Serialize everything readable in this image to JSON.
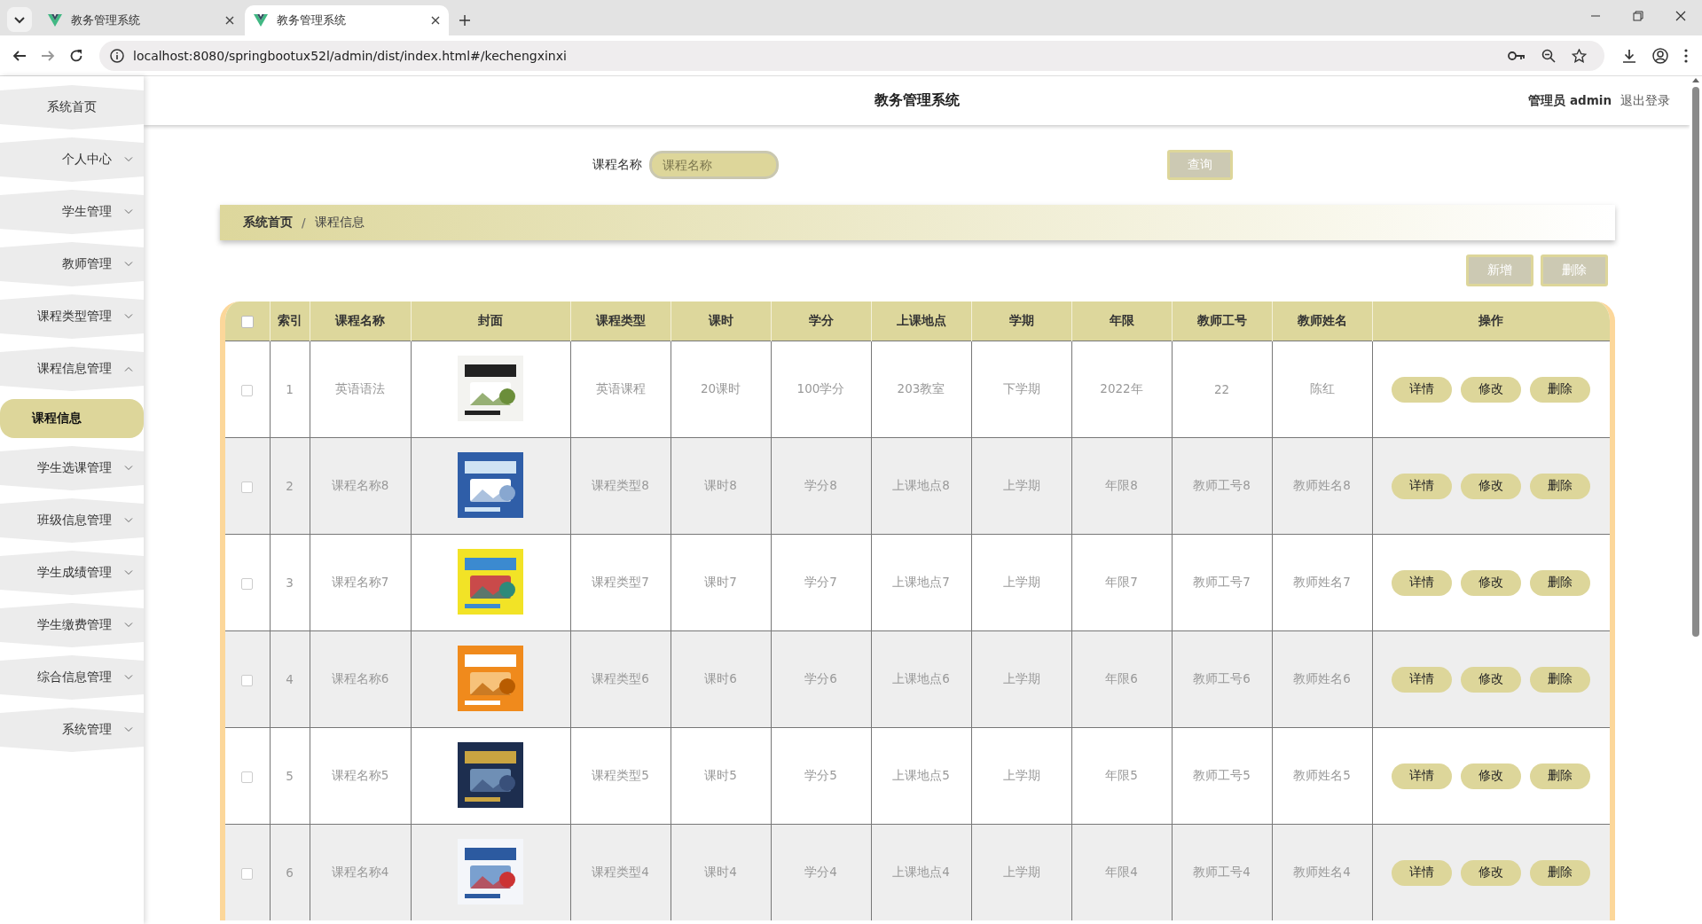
{
  "browser": {
    "tabs": [
      {
        "title": "教务管理系统",
        "selected": false
      },
      {
        "title": "教务管理系统",
        "selected": true
      }
    ],
    "url": "localhost:8080/springbootux52l/admin/dist/index.html#/kechengxinxi"
  },
  "header": {
    "title": "教务管理系统",
    "user": "管理员 admin",
    "logout": "退出登录"
  },
  "sidebar": {
    "items": [
      {
        "label": "系统首页"
      },
      {
        "label": "个人中心",
        "expanded": false
      },
      {
        "label": "学生管理",
        "expanded": false
      },
      {
        "label": "教师管理",
        "expanded": false
      },
      {
        "label": "课程类型管理",
        "expanded": false
      },
      {
        "label": "课程信息管理",
        "expanded": true,
        "children": [
          {
            "label": "课程信息",
            "selected": true
          }
        ]
      },
      {
        "label": "学生选课管理",
        "expanded": false
      },
      {
        "label": "班级信息管理",
        "expanded": false
      },
      {
        "label": "学生成绩管理",
        "expanded": false
      },
      {
        "label": "学生缴费管理",
        "expanded": false
      },
      {
        "label": "综合信息管理",
        "expanded": false
      },
      {
        "label": "系统管理",
        "expanded": false
      }
    ]
  },
  "search": {
    "label": "课程名称",
    "placeholder": "课程名称",
    "button": "查询"
  },
  "breadcrumb": {
    "items": [
      "系统首页",
      "课程信息"
    ],
    "separator": "/"
  },
  "toolbar": {
    "buttons": [
      "新增",
      "删除"
    ]
  },
  "table": {
    "select_all_checked": false,
    "columns": [
      "索引",
      "课程名称",
      "封面",
      "课程类型",
      "课时",
      "学分",
      "上课地点",
      "学期",
      "年限",
      "教师工号",
      "教师姓名",
      "操作"
    ],
    "rows": [
      {
        "checked": false,
        "index": "1",
        "name": "英语语法",
        "type": "英语课程",
        "hours": "20课时",
        "credits": "100学分",
        "location": "203教室",
        "term": "下学期",
        "years": "2022年",
        "teacher_id": "22",
        "teacher_name": "陈红",
        "actions": [
          "详情",
          "修改",
          "删除"
        ]
      },
      {
        "checked": false,
        "index": "2",
        "name": "课程名称8",
        "type": "课程类型8",
        "hours": "课时8",
        "credits": "学分8",
        "location": "上课地点8",
        "term": "上学期",
        "years": "年限8",
        "teacher_id": "教师工号8",
        "teacher_name": "教师姓名8",
        "actions": [
          "详情",
          "修改",
          "删除"
        ]
      },
      {
        "checked": false,
        "index": "3",
        "name": "课程名称7",
        "type": "课程类型7",
        "hours": "课时7",
        "credits": "学分7",
        "location": "上课地点7",
        "term": "上学期",
        "years": "年限7",
        "teacher_id": "教师工号7",
        "teacher_name": "教师姓名7",
        "actions": [
          "详情",
          "修改",
          "删除"
        ]
      },
      {
        "checked": false,
        "index": "4",
        "name": "课程名称6",
        "type": "课程类型6",
        "hours": "课时6",
        "credits": "学分6",
        "location": "上课地点6",
        "term": "上学期",
        "years": "年限6",
        "teacher_id": "教师工号6",
        "teacher_name": "教师姓名6",
        "actions": [
          "详情",
          "修改",
          "删除"
        ]
      },
      {
        "checked": false,
        "index": "5",
        "name": "课程名称5",
        "type": "课程类型5",
        "hours": "课时5",
        "credits": "学分5",
        "location": "上课地点5",
        "term": "上学期",
        "years": "年限5",
        "teacher_id": "教师工号5",
        "teacher_name": "教师姓名5",
        "actions": [
          "详情",
          "修改",
          "删除"
        ]
      },
      {
        "checked": false,
        "index": "6",
        "name": "课程名称4",
        "type": "课程类型4",
        "hours": "课时4",
        "credits": "学分4",
        "location": "上课地点4",
        "term": "上学期",
        "years": "年限4",
        "teacher_id": "教师工号4",
        "teacher_name": "教师姓名4",
        "actions": [
          "详情",
          "修改",
          "删除"
        ]
      }
    ]
  }
}
